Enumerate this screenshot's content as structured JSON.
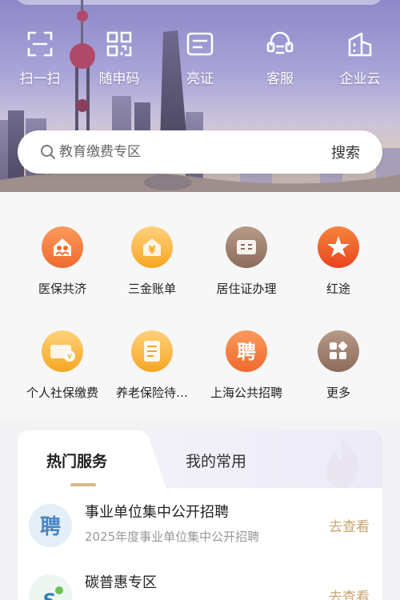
{
  "quick_actions": [
    {
      "label": "扫一扫",
      "icon": "scan-icon"
    },
    {
      "label": "随申码",
      "icon": "qr-code-icon"
    },
    {
      "label": "亮证",
      "icon": "card-icon"
    },
    {
      "label": "客服",
      "icon": "headset-icon"
    },
    {
      "label": "企业云",
      "icon": "enterprise-icon"
    }
  ],
  "search": {
    "placeholder": "教育缴费专区",
    "button_label": "搜索"
  },
  "services": [
    {
      "label": "医保共济",
      "icon": "medical-family-icon",
      "color": "#f37c3f"
    },
    {
      "label": "三金账单",
      "icon": "yuan-house-icon",
      "color": "#f5a623"
    },
    {
      "label": "居住证办理",
      "icon": "residence-permit-icon",
      "color": "#9b7b6b"
    },
    {
      "label": "红途",
      "icon": "red-star-icon",
      "color": "#ef5a2c"
    },
    {
      "label": "个人社保缴费",
      "icon": "social-insurance-icon",
      "color": "#f5a623"
    },
    {
      "label": "养老保险待…",
      "icon": "pension-doc-icon",
      "color": "#f5a623"
    },
    {
      "label": "上海公共招聘",
      "icon": "recruit-icon",
      "color": "#f37c3f"
    },
    {
      "label": "更多",
      "icon": "more-grid-icon",
      "color": "#9b7b6b"
    }
  ],
  "hot": {
    "tabs": [
      "热门服务",
      "我的常用"
    ],
    "items": [
      {
        "title": "事业单位集中公开招聘",
        "subtitle": "2025年度事业单位集中公开招聘",
        "action": "去查看"
      },
      {
        "title": "碳普惠专区",
        "subtitle": "",
        "action": "去查看"
      }
    ]
  }
}
